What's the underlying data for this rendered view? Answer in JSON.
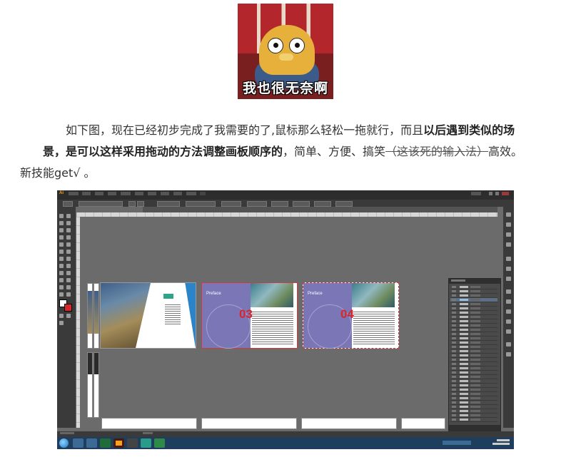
{
  "meme": {
    "caption": "我也很无奈啊"
  },
  "article": {
    "p1_a": "如下图，现在已经初步完成了我需要的了,鼠标那么轻松一拖就行，而且",
    "p1_bold1": "以后遇到类似的场景，是可以这样采用拖动的方法调整画板顺序的",
    "p1_b": "，简单、方便、搞笑",
    "p1_strike": "（这该死的输入法）",
    "p1_c": "高效。",
    "p2": "新技能get√ 。"
  },
  "ai_window": {
    "logo": "Ai",
    "artboards": [
      {
        "label": "03",
        "title": "Preface"
      },
      {
        "label": "04",
        "title": "Preface"
      }
    ]
  },
  "colors": {
    "accent_red": "#d8262b",
    "purple": "#7b76b6"
  },
  "icons": [
    "start-icon",
    "illustrator-icon",
    "folder-icon",
    "explorer-icon"
  ]
}
